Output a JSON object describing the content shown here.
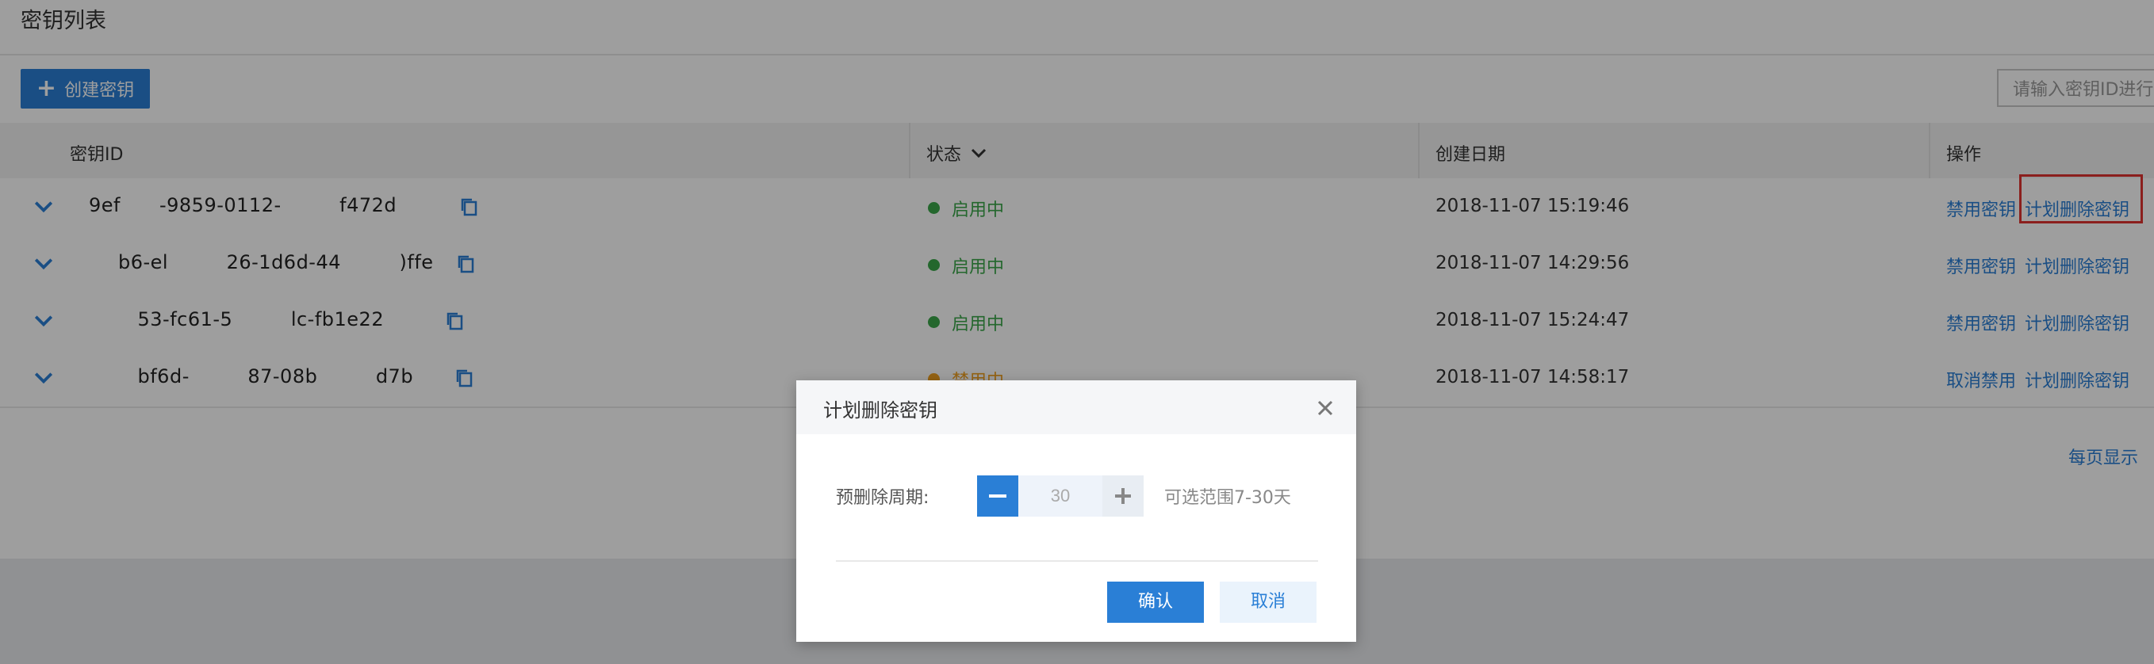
{
  "page": {
    "title": "密钥列表",
    "create_button_label": "创建密钥",
    "search_placeholder": "请输入密钥ID进行"
  },
  "table": {
    "columns": [
      "密钥ID",
      "状态",
      "创建日期",
      "操作"
    ],
    "rows": [
      {
        "key_id": "9ef  -9859-0112-   f472d",
        "status": "启用中",
        "status_color": "#3aa64a",
        "created": "2018-11-07 15:19:46",
        "action1": "禁用密钥",
        "action2": "计划删除密钥"
      },
      {
        "key_id": "  b6-el   26-1d6d-44   )ffe",
        "status": "启用中",
        "status_color": "#3aa64a",
        "created": "2018-11-07 14:29:56",
        "action1": "禁用密钥",
        "action2": "计划删除密钥"
      },
      {
        "key_id": "   53-fc61-5   lc-fb1e22   ",
        "status": "启用中",
        "status_color": "#3aa64a",
        "created": "2018-11-07 15:24:47",
        "action1": "禁用密钥",
        "action2": "计划删除密钥"
      },
      {
        "key_id": "   bf6d-   87-08b   d7b",
        "status": "禁用中",
        "status_color": "#f0a020",
        "created": "2018-11-07 14:58:17",
        "action1": "取消禁用",
        "action2": "计划删除密钥"
      }
    ]
  },
  "pager": {
    "page_size_label": "每页显示"
  },
  "modal": {
    "title": "计划删除密钥",
    "field_label": "预删除周期:",
    "value": "30",
    "range_hint": "可选范围7-30天",
    "confirm_label": "确认",
    "cancel_label": "取消"
  },
  "colors": {
    "accent": "#2a7fd6",
    "highlight_border": "#e0332f",
    "enabled": "#3aa64a",
    "disabled": "#f0a020"
  }
}
